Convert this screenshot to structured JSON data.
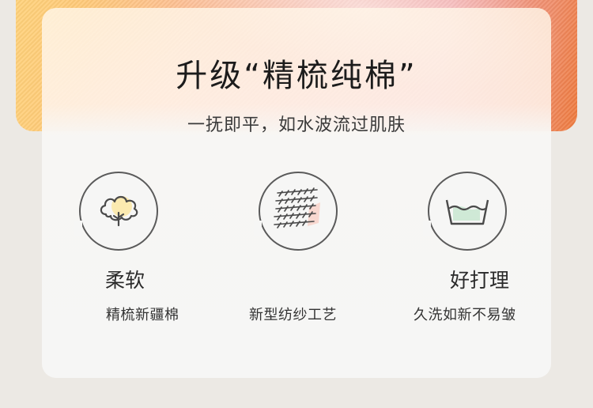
{
  "hero": {
    "title": "升级“精梳纯棉”",
    "subtitle": "一抚即平，如水波流过肌肤"
  },
  "features": [
    {
      "icon": "cotton-icon",
      "label": "柔软",
      "desc": "精梳新疆棉"
    },
    {
      "icon": "fabric-weave-icon",
      "label": "",
      "desc": "新型纺纱工艺"
    },
    {
      "icon": "wash-basin-icon",
      "label": "好打理",
      "desc": "久洗如新不易皱"
    }
  ],
  "colors": {
    "background": "#ece9e4",
    "card": "#f6f6f5",
    "icon_stroke": "#5a5a5a"
  }
}
